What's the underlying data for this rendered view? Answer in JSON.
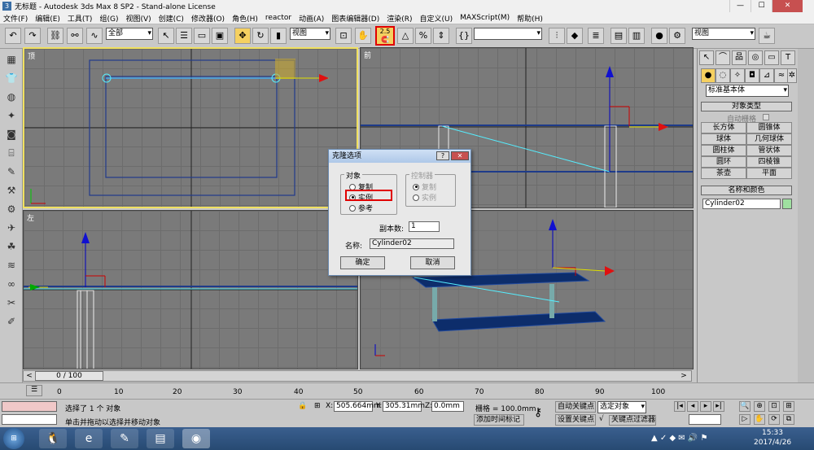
{
  "window": {
    "title": "无标题 - Autodesk 3ds Max 8 SP2 - Stand-alone License",
    "min": "—",
    "max": "☐",
    "close": "✕"
  },
  "menu": [
    "文件(F)",
    "编辑(E)",
    "工具(T)",
    "组(G)",
    "视图(V)",
    "创建(C)",
    "修改器(O)",
    "角色(H)",
    "reactor",
    "动画(A)",
    "图表编辑器(D)",
    "渲染(R)",
    "自定义(U)",
    "MAXScript(M)",
    "帮助(H)"
  ],
  "toolbar": {
    "selection_filter": "全部",
    "ref_coord": "视图",
    "named_sel": "",
    "render_combo": "视图",
    "snap_label": "2.5"
  },
  "viewports": {
    "top": "顶",
    "front": "前",
    "left": "左",
    "perspective": "透"
  },
  "command_panel": {
    "category": "标准基本体",
    "object_type_header": "对象类型",
    "autogrid": "自动栅格",
    "buttons": [
      "长方体",
      "圆锥体",
      "球体",
      "几何球体",
      "圆柱体",
      "管状体",
      "圆环",
      "四棱锥",
      "茶壶",
      "平面"
    ],
    "name_color_header": "名称和颜色",
    "name_value": "Cylinder02",
    "name_color": "#9fe0a0"
  },
  "dialog": {
    "title": "克隆选项",
    "help": "?",
    "close": "✕",
    "object_group": "对象",
    "options": [
      "复制",
      "实例",
      "参考"
    ],
    "selected": "实例",
    "controller_group": "控制器",
    "controller_options": [
      "复制",
      "实例"
    ],
    "copies_label": "副本数:",
    "copies_value": "1",
    "name_label": "名称:",
    "name_value": "Cylinder02",
    "ok": "确定",
    "cancel": "取消"
  },
  "timeline": {
    "position": "0 / 100",
    "ticks": [
      "0",
      "10",
      "20",
      "30",
      "40",
      "50",
      "60",
      "70",
      "80",
      "90",
      "100"
    ]
  },
  "status": {
    "selected": "选择了 1 个 对象",
    "prompt": "单击并拖动以选择并移动对象",
    "x_label": "X:",
    "x": "505.664mm",
    "y_label": "Y:",
    "y": "305.31mm",
    "z_label": "Z:",
    "z": "0.0mm",
    "grid": "栅格 = 100.0mm",
    "add_time_tag": "添加时间标记",
    "auto_key": "自动关键点",
    "set_key": "设置关键点",
    "selected_obj": "选定对象",
    "key_filters": "关键点过滤器"
  },
  "taskbar": {
    "time": "15:33",
    "date": "2017/4/26"
  },
  "colors": {
    "viewport_bg": "#7a7a7a",
    "highlight": "#e00000",
    "active_border": "#f0e060",
    "obj_blue": "#1a3a7a"
  }
}
